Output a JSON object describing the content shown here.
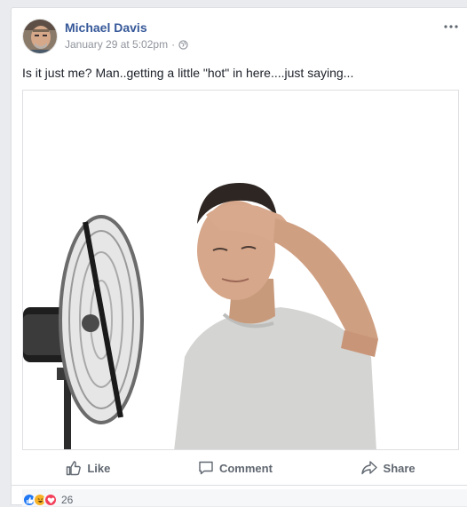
{
  "post": {
    "author": "Michael Davis",
    "timestamp": "January 29 at 5:02pm",
    "separator": "·",
    "privacy_icon": "globe-icon",
    "menu_icon": "more-options-icon",
    "text": "Is it just me? Man..getting a little \"hot\" in here....just saying..."
  },
  "actions": {
    "like_label": "Like",
    "comment_label": "Comment",
    "share_label": "Share"
  },
  "reactions": {
    "types": [
      "like",
      "haha",
      "love"
    ],
    "count": "26"
  },
  "colors": {
    "author": "#365899",
    "meta": "#90949c",
    "action": "#606770",
    "like_blue": "#2078f4",
    "haha_yellow": "#f7b125",
    "love_red": "#f33e58"
  }
}
